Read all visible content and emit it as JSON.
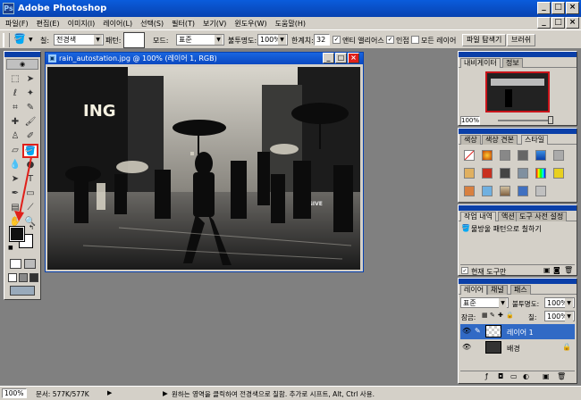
{
  "app": {
    "title": "Adobe Photoshop"
  },
  "menu": [
    "파일(F)",
    "편집(E)",
    "이미지(I)",
    "레이어(L)",
    "선택(S)",
    "필터(T)",
    "보기(V)",
    "윈도우(W)",
    "도움말(H)"
  ],
  "options": {
    "fill_label": "칠:",
    "fill_value": "전경색",
    "pattern_label": "패턴:",
    "mode_label": "모드:",
    "mode_value": "표준",
    "opacity_label": "불투명도:",
    "opacity_value": "100%",
    "tolerance_label": "한계치:",
    "tolerance_value": "32",
    "antialias_label": "앤티 앨리어스",
    "contiguous_label": "인접",
    "all_layers_label": "모든 레이어",
    "tab_file_browser": "파일 탐색기",
    "tab_brushes": "브러쉬"
  },
  "document": {
    "title": "rain_autostation.jpg @ 100% (레이어 1, RGB)"
  },
  "navigator": {
    "tabs": [
      "내비게이터",
      "정보"
    ],
    "zoom": "100%"
  },
  "swatches": {
    "tabs": [
      "색상",
      "색상 견본",
      "스타일"
    ]
  },
  "history": {
    "tabs": [
      "작업 내역",
      "액션",
      "도구 사전 설정"
    ],
    "item": "물방울 패턴으로 칠하기",
    "snapshot_label": "현재 도구만"
  },
  "layers": {
    "tabs": [
      "레이어",
      "채널",
      "패스"
    ],
    "blend_mode": "표준",
    "opacity_label": "불투명도:",
    "opacity_value": "100%",
    "lock_label": "잠금:",
    "fill_label": "칠:",
    "fill_value": "100%",
    "items": [
      {
        "name": "레이어 1"
      },
      {
        "name": "배경"
      }
    ]
  },
  "status": {
    "zoom": "100%",
    "doc": "문서: 577K/577K",
    "hint": "원하는 영역을 클릭하여 전경색으로 칠함. 추가로 시프트, Alt, Ctrl 사용."
  },
  "image_text": {
    "sign": "ING",
    "poster": "GIVE"
  },
  "colors": {
    "accent": "#0a3fa8",
    "annotation_red": "#e0201a",
    "highlight_layer": "#316ac5"
  }
}
